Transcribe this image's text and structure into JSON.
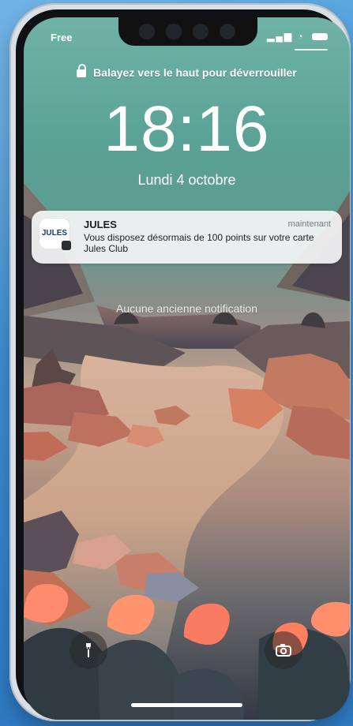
{
  "status_bar": {
    "carrier": "Free"
  },
  "lockscreen": {
    "unlock_hint": "Balayez vers le haut pour déverrouiller",
    "time": "18:16",
    "date": "Lundi 4 octobre",
    "older_notifications": "Aucune ancienne notification"
  },
  "notification": {
    "app_name": "JULES",
    "icon_label": "JULES",
    "timestamp": "maintenant",
    "message": "Vous disposez désormais de 100 points sur votre carte Jules Club"
  },
  "icons": {
    "lock": "lock-icon",
    "torch": "flashlight-icon",
    "camera": "camera-icon"
  }
}
